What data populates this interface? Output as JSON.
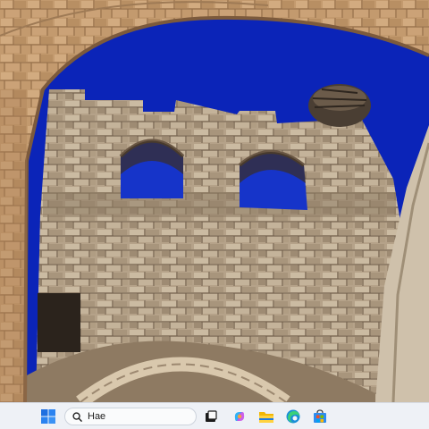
{
  "desktop": {
    "wallpaper_name": "stone-wall-ruin-wallpaper",
    "colors": {
      "sky": "#0b24b8",
      "stone": "#b9a58a",
      "stone_dark": "#7d6a55",
      "arch": "#caa27a"
    }
  },
  "taskbar": {
    "background": "#eef1f6",
    "start_icon": "windows-start-icon",
    "search": {
      "value": "Hae",
      "icon": "search-icon"
    },
    "pinned": [
      {
        "name": "task-view-icon"
      },
      {
        "name": "copilot-icon"
      },
      {
        "name": "file-explorer-icon"
      },
      {
        "name": "edge-browser-icon"
      },
      {
        "name": "microsoft-store-icon"
      }
    ]
  }
}
